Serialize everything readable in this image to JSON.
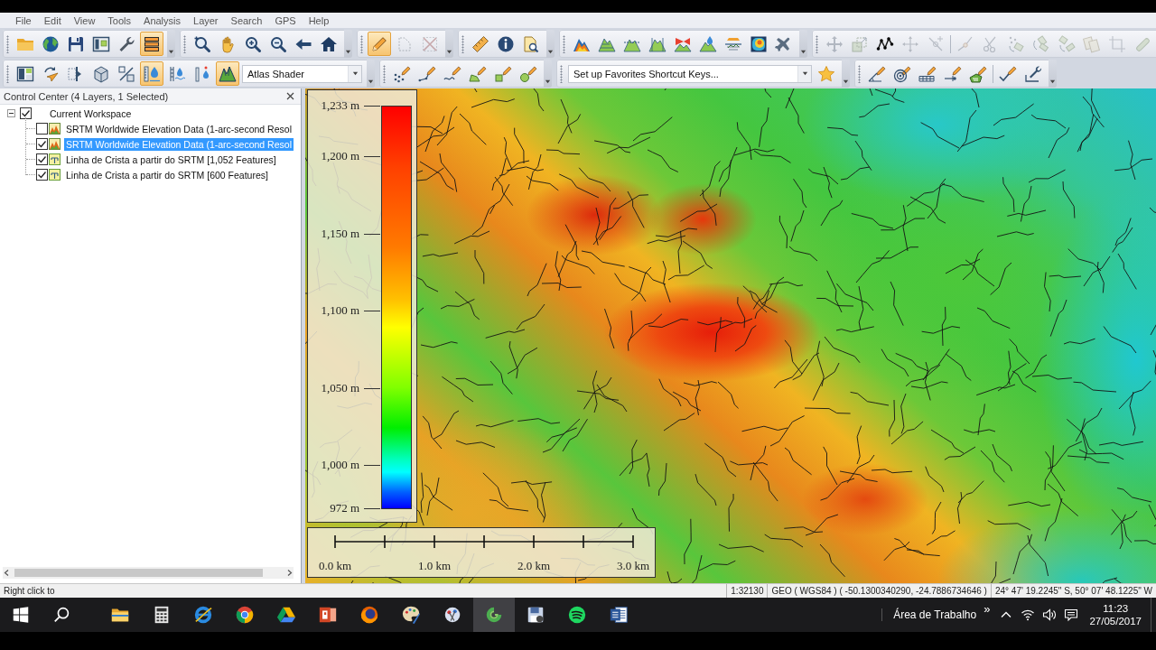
{
  "menu_bar": {
    "items": [
      "File",
      "Edit",
      "View",
      "Tools",
      "Analysis",
      "Layer",
      "Search",
      "GPS",
      "Help"
    ]
  },
  "toolbars": [
    {
      "groups": [
        {
          "items": [
            {
              "kind": "folder",
              "selected": false,
              "disabled": false
            },
            {
              "kind": "globe",
              "selected": false,
              "disabled": false
            },
            {
              "kind": "floppy-disk",
              "selected": false,
              "disabled": false
            },
            {
              "kind": "window-panes",
              "selected": false,
              "disabled": false
            },
            {
              "kind": "wrench",
              "selected": false,
              "disabled": false
            },
            {
              "kind": "layers",
              "selected": true,
              "disabled": false
            }
          ]
        },
        {
          "items": [
            {
              "kind": "zoom-box",
              "selected": false,
              "disabled": false
            },
            {
              "kind": "hand",
              "selected": false,
              "disabled": false
            },
            {
              "kind": "zoom-in",
              "selected": false,
              "disabled": false
            },
            {
              "kind": "zoom-out",
              "selected": false,
              "disabled": false
            },
            {
              "kind": "left-arrow",
              "selected": false,
              "disabled": false
            },
            {
              "kind": "house",
              "selected": false,
              "disabled": false
            }
          ]
        },
        {
          "items": [
            {
              "kind": "pencil",
              "selected": true,
              "disabled": false
            },
            {
              "kind": "dashed-box",
              "selected": false,
              "disabled": true
            },
            {
              "kind": "cross",
              "selected": false,
              "disabled": true
            }
          ]
        },
        {
          "items": [
            {
              "kind": "ruler",
              "selected": false,
              "disabled": false
            },
            {
              "kind": "info",
              "selected": false,
              "disabled": false
            },
            {
              "kind": "page-search",
              "selected": false,
              "disabled": false
            }
          ]
        },
        {
          "items": [
            {
              "kind": "peak",
              "selected": false,
              "disabled": false
            },
            {
              "kind": "peak-lines",
              "selected": false,
              "disabled": false
            },
            {
              "kind": "peak-profile",
              "selected": false,
              "disabled": false
            },
            {
              "kind": "peak-section",
              "selected": false,
              "disabled": false
            },
            {
              "kind": "peak-rays",
              "selected": false,
              "disabled": false
            },
            {
              "kind": "peak-drop",
              "selected": false,
              "disabled": false
            },
            {
              "kind": "slice",
              "selected": false,
              "disabled": false
            },
            {
              "kind": "contour-square",
              "selected": false,
              "disabled": false
            },
            {
              "kind": "plane",
              "selected": false,
              "disabled": false
            }
          ]
        },
        {
          "items": [
            {
              "kind": "move-arrows",
              "selected": false,
              "disabled": true
            },
            {
              "kind": "move-boxes",
              "selected": false,
              "disabled": true
            },
            {
              "kind": "vertices",
              "selected": false,
              "disabled": false
            },
            {
              "kind": "cross-arrows",
              "selected": false,
              "disabled": true
            },
            {
              "kind": "point-cross",
              "selected": false,
              "disabled": true
            },
            {
              "kind": "separator"
            },
            {
              "kind": "line-vertex",
              "selected": false,
              "disabled": true
            },
            {
              "kind": "scissors",
              "selected": false,
              "disabled": true
            },
            {
              "kind": "dots-box",
              "selected": false,
              "disabled": true
            },
            {
              "kind": "box-rotate",
              "selected": false,
              "disabled": true
            },
            {
              "kind": "boxes-rotate",
              "selected": false,
              "disabled": true
            },
            {
              "kind": "copies",
              "selected": false,
              "disabled": true
            },
            {
              "kind": "crop",
              "selected": false,
              "disabled": true
            },
            {
              "kind": "clip",
              "selected": false,
              "disabled": true
            }
          ]
        }
      ]
    },
    {
      "groups": [
        {
          "items": [
            {
              "kind": "panes",
              "selected": false,
              "disabled": false
            },
            {
              "kind": "rotate-arrow",
              "selected": false,
              "disabled": false
            },
            {
              "kind": "split-bar",
              "selected": false,
              "disabled": false
            },
            {
              "kind": "cube",
              "selected": false,
              "disabled": false
            },
            {
              "kind": "slash-box",
              "selected": false,
              "disabled": false
            },
            {
              "kind": "drop-ruler",
              "selected": true,
              "disabled": false
            },
            {
              "kind": "drop-gauge",
              "selected": false,
              "disabled": false
            },
            {
              "kind": "gauge-drop",
              "selected": false,
              "disabled": false
            },
            {
              "kind": "peaks",
              "selected": true,
              "disabled": false
            },
            {
              "kind": "combo",
              "value": "Atlas Shader"
            }
          ]
        },
        {
          "items": [
            {
              "kind": "sketch-points",
              "selected": false,
              "disabled": false
            },
            {
              "kind": "sketch-line",
              "selected": false,
              "disabled": false
            },
            {
              "kind": "sketch-curve",
              "selected": false,
              "disabled": false
            },
            {
              "kind": "sketch-area",
              "selected": false,
              "disabled": false
            },
            {
              "kind": "sketch-square",
              "selected": false,
              "disabled": false
            },
            {
              "kind": "sketch-circle",
              "selected": false,
              "disabled": false
            }
          ]
        },
        {
          "items": [
            {
              "kind": "combo",
              "value": "Set up Favorites Shortcut Keys..."
            },
            {
              "kind": "star",
              "selected": false,
              "disabled": false
            }
          ]
        },
        {
          "items": [
            {
              "kind": "sketch-angle",
              "selected": false,
              "disabled": false
            },
            {
              "kind": "sketch-target",
              "selected": false,
              "disabled": false
            },
            {
              "kind": "sketch-grid",
              "selected": false,
              "disabled": false
            },
            {
              "kind": "sketch-node",
              "selected": false,
              "disabled": false
            },
            {
              "kind": "sketch-polygon",
              "selected": false,
              "disabled": false
            },
            {
              "kind": "separator"
            },
            {
              "kind": "sketch-check",
              "selected": false,
              "disabled": false
            },
            {
              "kind": "edit-wrench",
              "selected": false,
              "disabled": false
            }
          ]
        }
      ]
    }
  ],
  "control_center": {
    "title": "Control Center (4 Layers, 1 Selected)",
    "tree": [
      {
        "label": "Current Workspace",
        "checked": true,
        "expanded": true,
        "selected": false,
        "children": [
          {
            "label": "SRTM Worldwide Elevation Data (1-arc-second Resol",
            "kind": "raster",
            "checked": false,
            "selected": false
          },
          {
            "label": "SRTM Worldwide Elevation Data (1-arc-second Resol",
            "kind": "raster",
            "checked": true,
            "selected": true
          },
          {
            "label": "Linha de Crista a partir do SRTM [1,052 Features]",
            "kind": "vector",
            "checked": true,
            "selected": false
          },
          {
            "label": "Linha de Crista a partir do SRTM [600 Features]",
            "kind": "vector",
            "checked": true,
            "selected": false
          }
        ]
      }
    ]
  },
  "legend": {
    "ticks": [
      "1,233 m",
      "1,200 m",
      "1,150 m",
      "1,100 m",
      "1,050 m",
      "1,000 m",
      "972 m"
    ]
  },
  "scale_bar": {
    "labels": [
      "0.0 km",
      "1.0 km",
      "2.0 km",
      "3.0 km"
    ]
  },
  "status_bar": {
    "hint": "Right click to",
    "scale": "1:32130",
    "projected": "GEO ( WGS84 ) ( -50.1300340290, -24.7886734646 )",
    "geographic": "24° 47' 19.2245\" S, 50° 07' 48.1225\" W"
  },
  "taskbar": {
    "apps": [
      {
        "kind": "folder",
        "selected": false
      },
      {
        "kind": "calculator",
        "selected": false
      },
      {
        "kind": "ring",
        "selected": false
      },
      {
        "kind": "pinwheel",
        "selected": false
      },
      {
        "kind": "triangle",
        "selected": false
      },
      {
        "kind": "slide",
        "selected": false
      },
      {
        "kind": "orb",
        "selected": false
      },
      {
        "kind": "palette",
        "selected": false
      },
      {
        "kind": "pin-board",
        "selected": false
      },
      {
        "kind": "swirl",
        "selected": true
      },
      {
        "kind": "floppy-disk",
        "selected": false
      },
      {
        "kind": "sound-waves",
        "selected": false
      },
      {
        "kind": "document",
        "selected": false
      }
    ],
    "tray": {
      "desktop_label": "Área de Trabalho",
      "overflow": "»",
      "time": "11:23",
      "date": "27/05/2017"
    }
  }
}
